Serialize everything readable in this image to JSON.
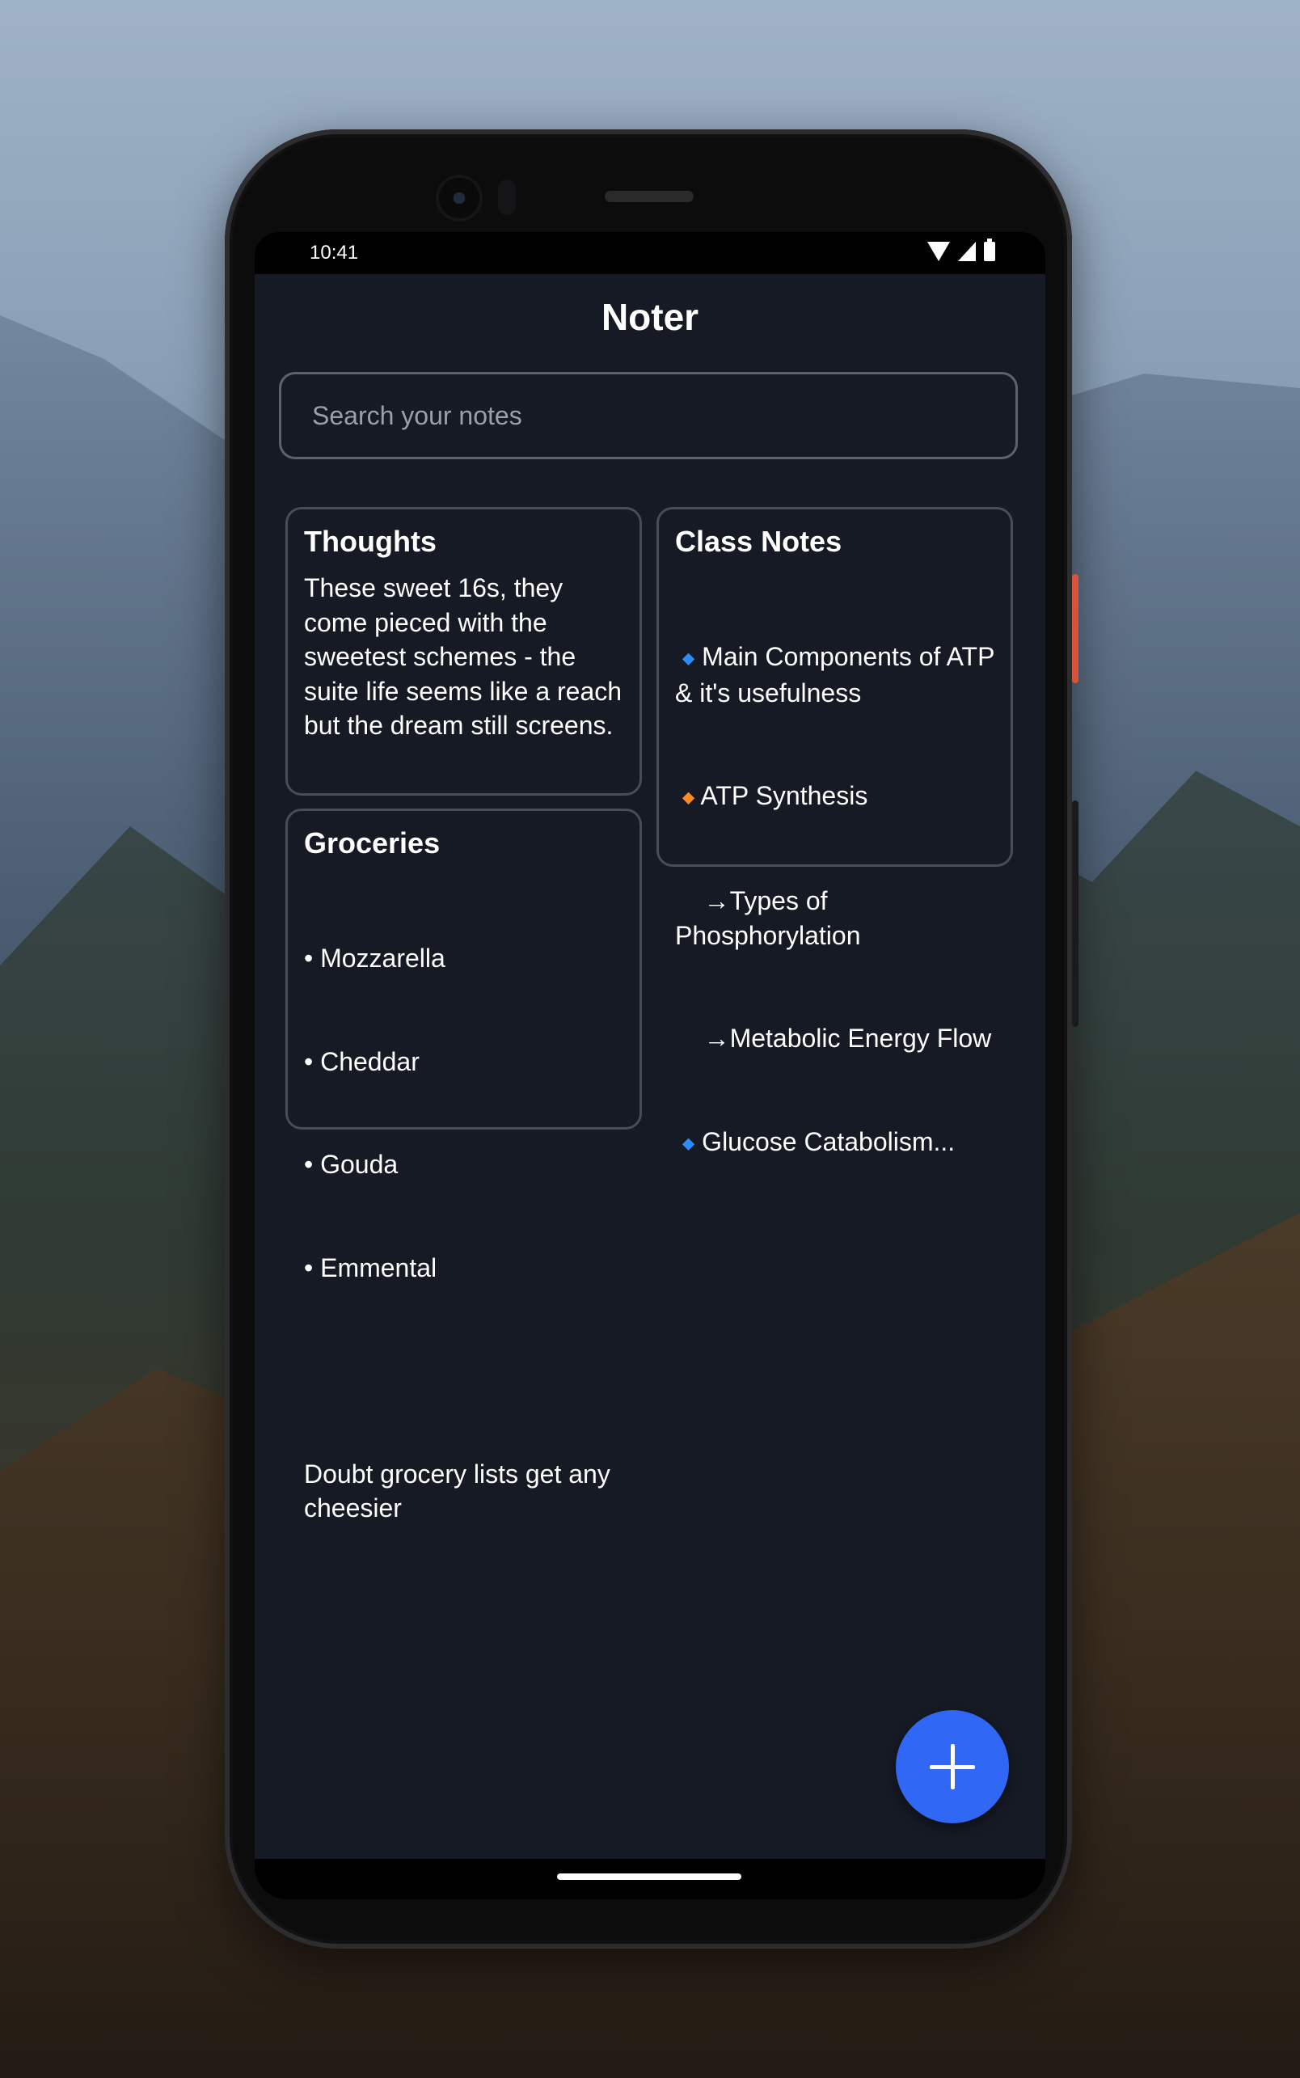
{
  "status_bar": {
    "time": "10:41"
  },
  "app": {
    "title": "Noter"
  },
  "search": {
    "placeholder": "Search your notes",
    "value": ""
  },
  "notes": [
    {
      "title": "Thoughts",
      "body": "These sweet 16s, they come pieced with the sweetest schemes - the suite life seems like a reach but the dream still screens."
    },
    {
      "title": "Groceries",
      "lines": [
        "• Mozzarella",
        "• Cheddar",
        "• Gouda",
        "• Emmental",
        "",
        "Doubt grocery lists get any cheesier"
      ]
    },
    {
      "title": "Class Notes",
      "items": [
        {
          "marker": "🔹",
          "text": "Main Components of ATP & it's usefulness"
        },
        {
          "marker": "🔸",
          "text": "ATP Synthesis"
        },
        {
          "marker": "→",
          "text": "Types of Phosphorylation"
        },
        {
          "marker": "→",
          "text": "Metabolic Energy Flow"
        },
        {
          "marker": "🔹",
          "text": "Glucose Catabolism..."
        }
      ]
    }
  ],
  "fab": {
    "icon": "plus-icon"
  },
  "colors": {
    "background": "#161a24",
    "card_border": "#474c58",
    "accent": "#3068f5"
  }
}
